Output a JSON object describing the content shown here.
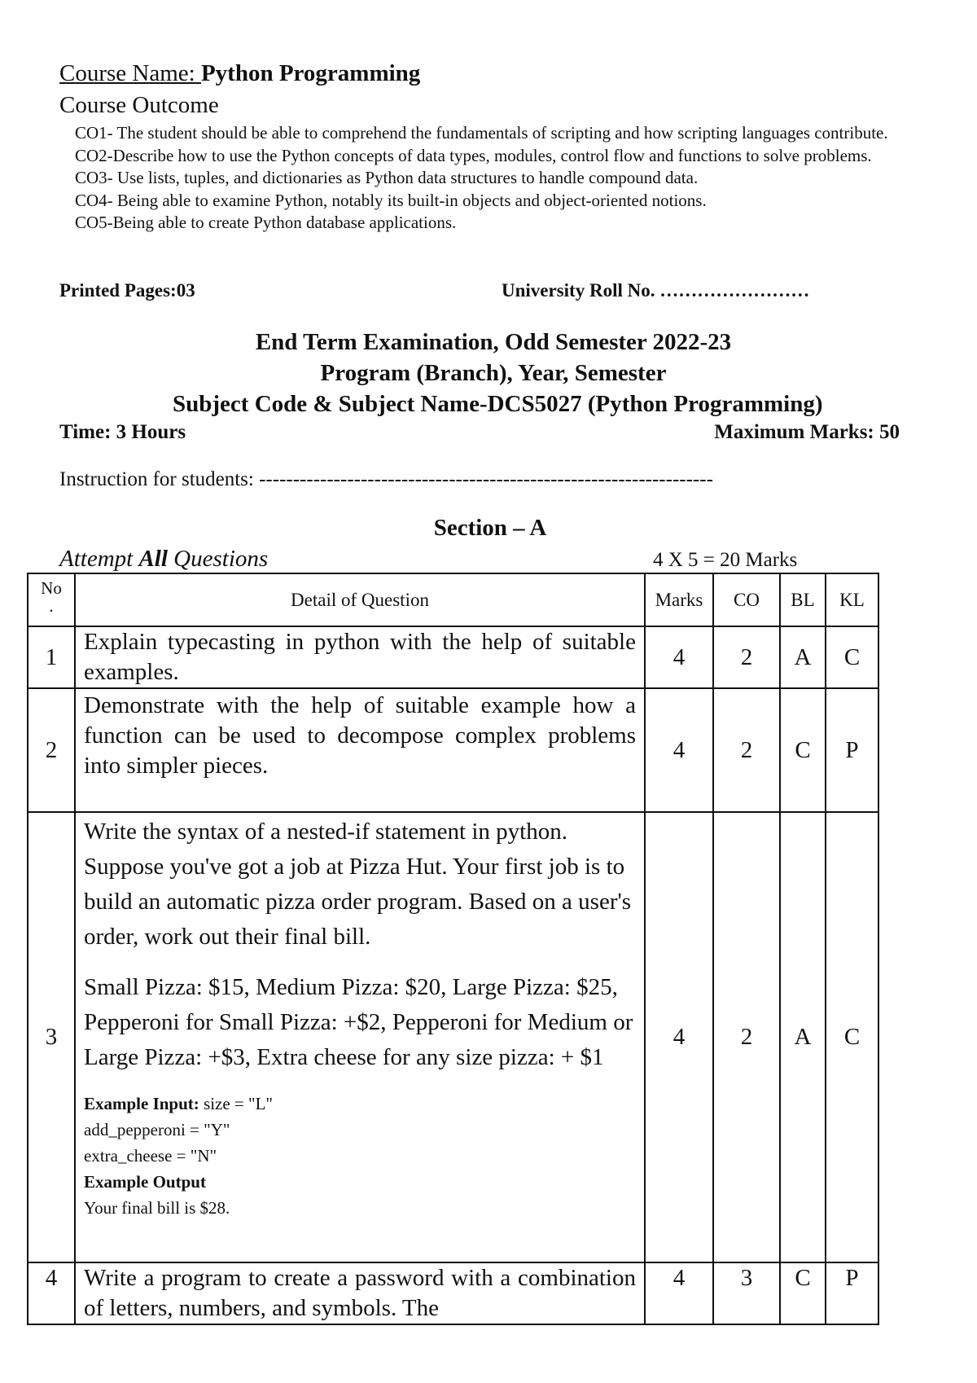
{
  "header": {
    "course_name_label": "Course Name: ",
    "course_name_value": "Python Programming",
    "course_outcome_title": "Course Outcome",
    "course_outcomes": [
      "CO1- The student should be able to comprehend the fundamentals of scripting and how scripting languages contribute.",
      "CO2-Describe how to use the Python concepts of data types, modules, control flow and functions to solve problems.",
      "CO3- Use lists, tuples, and dictionaries as Python data structures to handle compound data.",
      "CO4- Being able to examine Python, notably its built-in objects and object-oriented notions.",
      "CO5-Being able to create Python database applications."
    ],
    "printed_pages": "Printed Pages:03",
    "university_roll": "University Roll No. ……………………"
  },
  "exam": {
    "title": "End Term Examination, Odd Semester 2022-23",
    "program": "Program (Branch), Year, Semester",
    "subject": "Subject Code & Subject Name-DCS5027 (Python Programming)",
    "time": "Time: 3 Hours",
    "max_marks": "Maximum Marks: 50",
    "instruction": "Instruction for students: -------------------------------------------------------------------"
  },
  "section": {
    "title": "Section – A",
    "attempt_prefix": "Attempt ",
    "attempt_bold": "All",
    "attempt_suffix": " Questions",
    "marks_summary": "4 X 5 = 20 Marks"
  },
  "table": {
    "headers": {
      "no": "No",
      "no_dot": ".",
      "detail": "Detail of Question",
      "marks": "Marks",
      "co": "CO",
      "bl": "BL",
      "kl": "KL"
    },
    "rows": [
      {
        "no": "1",
        "question": "Explain typecasting in python with the help of suitable examples.",
        "marks": "4",
        "co": "2",
        "bl": "A",
        "kl": "C"
      },
      {
        "no": "2",
        "question": "Demonstrate with the help of suitable example how a function can be used to decompose complex problems into simpler pieces.",
        "marks": "4",
        "co": "2",
        "bl": "C",
        "kl": "P"
      },
      {
        "no": "3",
        "question_p1": "Write the syntax of a nested-if statement in python. Suppose you've got a job at Pizza Hut. Your first job is to build an automatic pizza order program. Based on a user's order, work out their final bill.",
        "question_p2": "Small Pizza: $15, Medium Pizza: $20, Large Pizza: $25, Pepperoni for Small Pizza: +$2, Pepperoni for Medium or Large Pizza: +$3, Extra cheese for any size pizza: + $1",
        "example_input_label": "Example Input:",
        "example_input_1": " size = \"L\"",
        "example_input_2": "add_pepperoni = \"Y\"",
        "example_input_3": "extra_cheese = \"N\"",
        "example_output_label": "Example Output",
        "example_output": "Your final bill is $28.",
        "marks": "4",
        "co": "2",
        "bl": "A",
        "kl": "C"
      },
      {
        "no": "4",
        "question": "Write a program to create a password with a combination of letters, numbers, and symbols. The",
        "marks": "4",
        "co": "3",
        "bl": "C",
        "kl": "P"
      }
    ]
  }
}
